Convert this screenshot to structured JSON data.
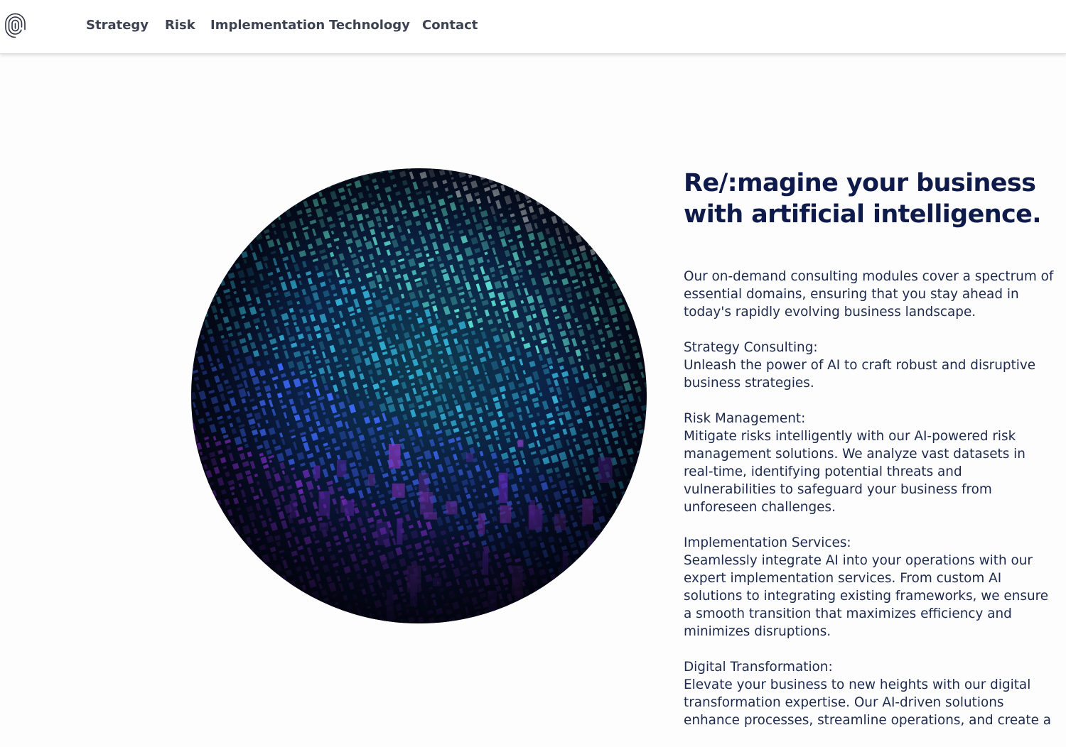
{
  "nav": {
    "logo_icon": "fingerprint-icon",
    "items": [
      {
        "label": "Strategy"
      },
      {
        "label": "Risk"
      },
      {
        "label": "Implementation"
      },
      {
        "label": "Technology"
      },
      {
        "label": "Contact"
      }
    ]
  },
  "hero": {
    "image_icon": "ai-data-circle-image"
  },
  "content": {
    "headline_line1": "Re/:magine your business",
    "headline_line2": "with artificial intelligence.",
    "intro": "Our on-demand consulting modules cover a spectrum of essential domains, ensuring that you stay ahead in today's rapidly evolving business landscape.",
    "sections": [
      {
        "title": "Strategy Consulting:",
        "text": "Unleash the power of AI to craft robust and disruptive business strategies."
      },
      {
        "title": "Risk Management:",
        "text": "Mitigate risks intelligently with our AI-powered risk management solutions. We analyze vast datasets in real-time, identifying potential threats and vulnerabilities to safeguard your business from unforeseen challenges."
      },
      {
        "title": "Implementation Services:",
        "text": "Seamlessly integrate AI into your operations with our expert implementation services. From custom AI solutions to integrating existing frameworks, we ensure a smooth transition that maximizes efficiency and minimizes disruptions."
      },
      {
        "title": "Digital Transformation:",
        "text": "Elevate your business to new heights with our digital transformation expertise. Our AI-driven solutions enhance processes, streamline operations, and create a"
      }
    ]
  },
  "colors": {
    "headline": "#0e1a4a",
    "body_text": "#1d2a4d",
    "nav_text": "#3c4250",
    "glyph_teal": "#5fe6d8",
    "glyph_blue": "#3f6cff",
    "glyph_purple": "#a33cff"
  }
}
